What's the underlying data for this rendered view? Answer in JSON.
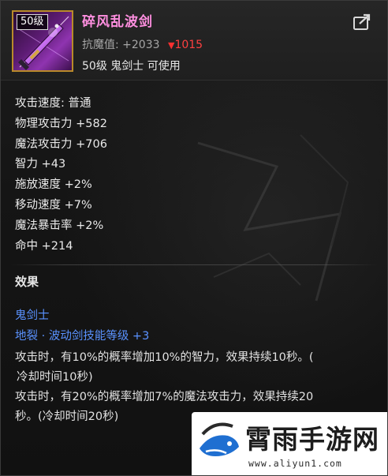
{
  "item": {
    "level_tag": "50级",
    "name": "碎风乱波剑",
    "magic_resist_label": "抗魔值: +2033",
    "magic_resist_down": "1015",
    "usable": "50级 鬼剑士 可使用"
  },
  "stats": [
    "攻击速度: 普通",
    "物理攻击力 +582",
    "魔法攻击力 +706",
    "智力 +43",
    "施放速度 +2%",
    "移动速度 +7%",
    "魔法暴击率 +2%",
    "命中 +214"
  ],
  "effect": {
    "title": "效果",
    "class_name": "鬼剑士",
    "skill_bonus": "地裂 · 波动剑技能等级 +3",
    "lines": [
      "攻击时，有10%的概率增加10%的智力，效果持续10秒。(",
      "冷却时间10秒)",
      "攻击时，有20%的概率增加7%的魔法攻击力，效果持续20",
      "秒。(冷却时间20秒)"
    ]
  },
  "watermark": {
    "title": "霄雨手游网",
    "url": "www.aliyun1.com"
  },
  "colors": {
    "item_name": "#ff8fe0",
    "class_blue": "#5a92ff",
    "resist_down": "#ff4040",
    "icon_border": "#b98a2a"
  },
  "icons": {
    "share": "share-icon",
    "weapon": "sword-icon",
    "down_arrow": "down-triangle-icon",
    "logo": "fish-logo-icon"
  }
}
